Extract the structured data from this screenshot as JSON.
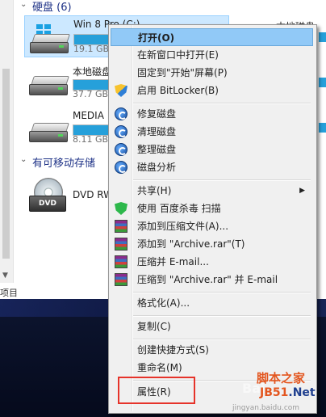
{
  "explorer": {
    "group_drives": "硬盘 (6)",
    "group_removable": "有可移动存储",
    "status_left": "项目",
    "drives": [
      {
        "label": "Win 8 Pro (C:)",
        "free": "19.1 GB",
        "usage_percent": 85,
        "selected": true
      },
      {
        "label": "本地磁盘",
        "free": "37.7 GB",
        "usage_percent": 70
      },
      {
        "label": "MEDIA",
        "free": "8.11 GB",
        "usage_percent": 90
      }
    ],
    "dvd_label": "DVD RW",
    "right_clip_label": "本地磁盘"
  },
  "menu": {
    "items": [
      {
        "label": "打开(O)",
        "highlighted": true
      },
      {
        "label": "在新窗口中打开(E)"
      },
      {
        "label": "固定到\"开始\"屏幕(P)"
      },
      {
        "label": "启用 BitLocker(B)",
        "icon": "shield-icon"
      },
      {
        "label": "修复磁盘",
        "icon": "disk-tool-icon"
      },
      {
        "label": "清理磁盘",
        "icon": "disk-tool-icon"
      },
      {
        "label": "整理磁盘",
        "icon": "disk-tool-icon"
      },
      {
        "label": "磁盘分析",
        "icon": "disk-tool-icon"
      },
      {
        "label": "共享(H)",
        "has_submenu": true
      },
      {
        "label": "使用 百度杀毒 扫描",
        "icon": "antivirus-icon"
      },
      {
        "label": "添加到压缩文件(A)...",
        "icon": "winrar-icon"
      },
      {
        "label": "添加到 \"Archive.rar\"(T)",
        "icon": "winrar-icon"
      },
      {
        "label": "压缩并 E-mail...",
        "icon": "winrar-icon"
      },
      {
        "label": "压缩到 \"Archive.rar\" 并 E-mail",
        "icon": "winrar-icon"
      },
      {
        "label": "格式化(A)..."
      },
      {
        "label": "复制(C)"
      },
      {
        "label": "创建快捷方式(S)"
      },
      {
        "label": "重命名(M)"
      },
      {
        "label": "属性(R)"
      }
    ]
  },
  "watermark": {
    "brand": "脚本之家",
    "site_a": "JB51",
    "site_b": ".Net",
    "baidu": "Bai",
    "url": "jingyan.baidu.com"
  },
  "colors": {
    "accent": "#26a0da",
    "highlight": "#91c9f7",
    "callout": "#e6332a"
  }
}
